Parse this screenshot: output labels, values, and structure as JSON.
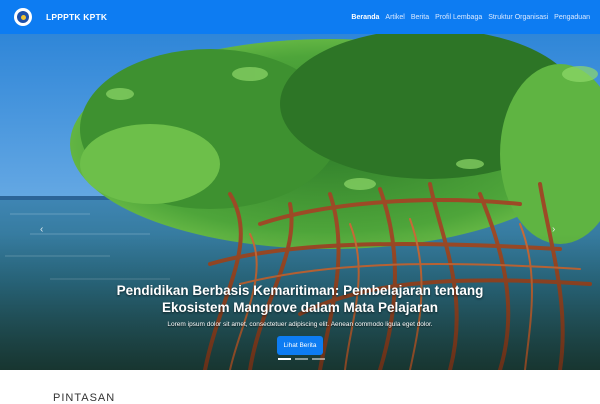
{
  "navbar": {
    "brand": "LPPPTK KPTK",
    "links": [
      {
        "label": "Beranda",
        "active": true
      },
      {
        "label": "Artikel",
        "active": false
      },
      {
        "label": "Berita",
        "active": false
      },
      {
        "label": "Profil Lembaga",
        "active": false
      },
      {
        "label": "Struktur Organisasi",
        "active": false
      },
      {
        "label": "Pengaduan",
        "active": false
      }
    ]
  },
  "hero": {
    "title_line1": "Pendidikan Berbasis Kemaritiman: Pembelajaran tentang",
    "title_line2": "Ekosistem Mangrove dalam Mata Pelajaran",
    "subtitle": "Lorem ipsum dolor sit amet, consectetuer adipiscing elit. Aenean commodo ligula eget dolor.",
    "button_label": "Lihat Berita",
    "prev_icon": "‹",
    "next_icon": "›",
    "slide_count": 3,
    "active_slide": 1
  },
  "section": {
    "title": "PINTASAN"
  },
  "colors": {
    "navbar": "#0d7cf2",
    "button": "#0d7cf2"
  }
}
